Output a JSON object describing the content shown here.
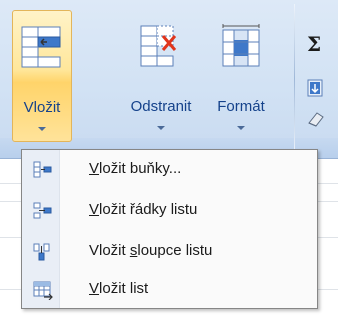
{
  "ribbon": {
    "buttons": [
      {
        "label": "Vložit",
        "icon": "insert-cells-icon",
        "state": "pressed"
      },
      {
        "label": "Odstranit",
        "icon": "delete-cells-icon"
      },
      {
        "label": "Formát",
        "icon": "format-cells-icon"
      }
    ],
    "sigma": "Σ",
    "side_icons": [
      "autosum-icon",
      "fill-icon",
      "clear-icon"
    ]
  },
  "menu": {
    "items": [
      {
        "pre": "",
        "ul": "V",
        "post": "ložit buňky...",
        "icon": "insert-cells-small-icon"
      },
      {
        "pre": "",
        "ul": "V",
        "post": "ložit řádky listu",
        "icon": "insert-rows-icon"
      },
      {
        "pre": "Vložit ",
        "ul": "s",
        "post": "loupce listu",
        "icon": "insert-columns-icon"
      },
      {
        "pre": "",
        "ul": "V",
        "post": "ložit list",
        "icon": "insert-sheet-icon"
      }
    ]
  },
  "colors": {
    "accent": "#15428b",
    "highlight": "#ffd46a",
    "ribbon": "#d2e2f4"
  }
}
